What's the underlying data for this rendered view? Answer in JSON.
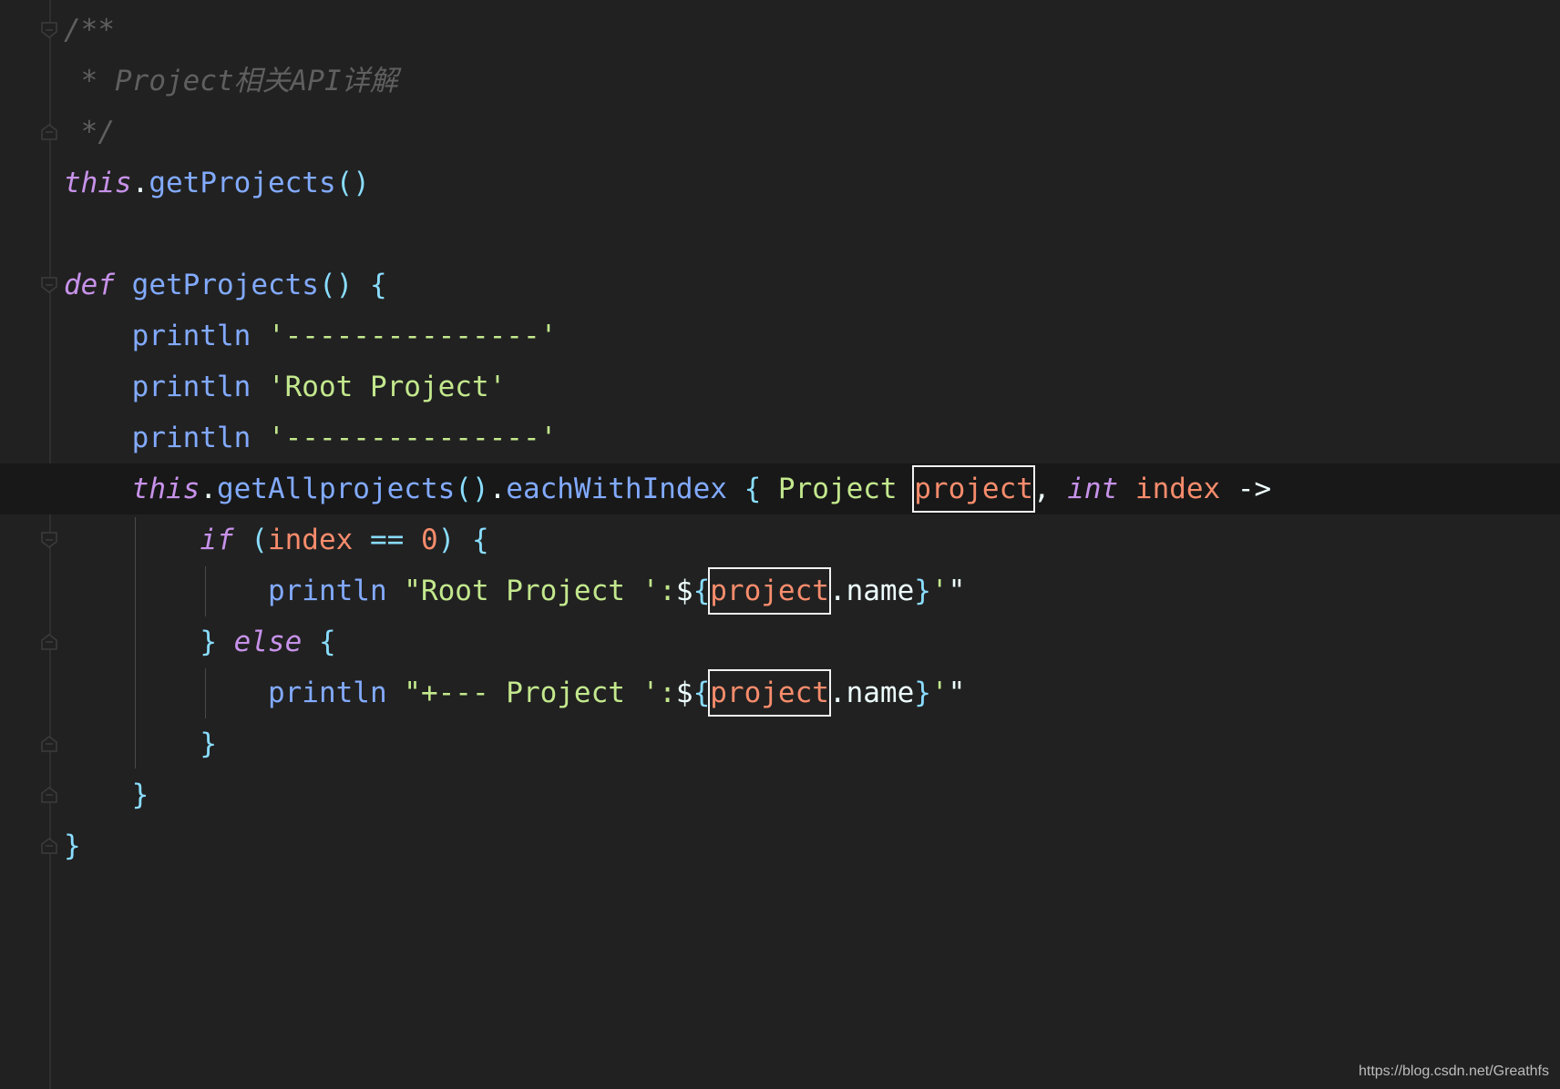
{
  "syntax_colors": {
    "comment": "#5f5f5f",
    "keyword": "#c792ea",
    "function": "#82aaff",
    "punct": "#89ddff",
    "string": "#c3e88d",
    "param": "#f78c6c",
    "plain": "#eeffff",
    "type": "#c3e88d"
  },
  "code_lines": [
    [
      {
        "t": "/**",
        "c": "comment",
        "i": true
      }
    ],
    [
      {
        "t": " * Project相关API详解",
        "c": "comment",
        "i": true
      }
    ],
    [
      {
        "t": " */",
        "c": "comment",
        "i": true
      }
    ],
    [
      {
        "t": "this",
        "c": "keyword",
        "i": true
      },
      {
        "t": ".",
        "c": "plain"
      },
      {
        "t": "getProjects",
        "c": "function"
      },
      {
        "t": "()",
        "c": "punct"
      }
    ],
    [],
    [
      {
        "t": "def",
        "c": "keyword",
        "i": true
      },
      {
        "t": " "
      },
      {
        "t": "getProjects",
        "c": "function"
      },
      {
        "t": "() {",
        "c": "punct"
      }
    ],
    [
      {
        "t": "    "
      },
      {
        "t": "println",
        "c": "function"
      },
      {
        "t": " "
      },
      {
        "t": "'---------------'",
        "c": "string"
      }
    ],
    [
      {
        "t": "    "
      },
      {
        "t": "println",
        "c": "function"
      },
      {
        "t": " "
      },
      {
        "t": "'Root Project'",
        "c": "string"
      }
    ],
    [
      {
        "t": "    "
      },
      {
        "t": "println",
        "c": "function"
      },
      {
        "t": " "
      },
      {
        "t": "'---------------'",
        "c": "string"
      }
    ],
    [
      {
        "t": "    "
      },
      {
        "t": "this",
        "c": "keyword",
        "i": true
      },
      {
        "t": ".",
        "c": "plain"
      },
      {
        "t": "getAllprojects",
        "c": "function"
      },
      {
        "t": "()",
        "c": "punct"
      },
      {
        "t": ".",
        "c": "plain"
      },
      {
        "t": "eachWithIndex",
        "c": "function"
      },
      {
        "t": " { ",
        "c": "punct"
      },
      {
        "t": "Project",
        "c": "type"
      },
      {
        "t": " "
      },
      {
        "t": "project",
        "c": "param",
        "box": true
      },
      {
        "t": ", ",
        "c": "plain"
      },
      {
        "t": "int",
        "c": "keyword",
        "i": true
      },
      {
        "t": " "
      },
      {
        "t": "index",
        "c": "param"
      },
      {
        "t": " ->",
        "c": "plain"
      }
    ],
    [
      {
        "t": "        "
      },
      {
        "t": "if",
        "c": "keyword",
        "i": true
      },
      {
        "t": " (",
        "c": "punct"
      },
      {
        "t": "index",
        "c": "param"
      },
      {
        "t": " == ",
        "c": "punct"
      },
      {
        "t": "0",
        "c": "param"
      },
      {
        "t": ") {",
        "c": "punct"
      }
    ],
    [
      {
        "t": "            "
      },
      {
        "t": "println",
        "c": "function"
      },
      {
        "t": " "
      },
      {
        "t": "\"Root Project ':",
        "c": "string"
      },
      {
        "t": "$",
        "c": "plain"
      },
      {
        "t": "{",
        "c": "punct"
      },
      {
        "t": "project",
        "c": "param",
        "box": true
      },
      {
        "t": ".name",
        "c": "plain"
      },
      {
        "t": "}",
        "c": "punct"
      },
      {
        "t": "'",
        "c": "string"
      },
      {
        "t": "\"",
        "c": "plain"
      }
    ],
    [
      {
        "t": "        "
      },
      {
        "t": "} ",
        "c": "punct"
      },
      {
        "t": "else",
        "c": "keyword",
        "i": true
      },
      {
        "t": " {",
        "c": "punct"
      }
    ],
    [
      {
        "t": "            "
      },
      {
        "t": "println",
        "c": "function"
      },
      {
        "t": " "
      },
      {
        "t": "\"+--- Project ':",
        "c": "string"
      },
      {
        "t": "$",
        "c": "plain"
      },
      {
        "t": "{",
        "c": "punct"
      },
      {
        "t": "project",
        "c": "param",
        "box": true
      },
      {
        "t": ".name",
        "c": "plain"
      },
      {
        "t": "}",
        "c": "punct"
      },
      {
        "t": "'",
        "c": "string"
      },
      {
        "t": "\"",
        "c": "plain"
      }
    ],
    [
      {
        "t": "        "
      },
      {
        "t": "}",
        "c": "punct"
      }
    ],
    [
      {
        "t": "    "
      },
      {
        "t": "}",
        "c": "punct"
      }
    ],
    [
      {
        "t": "}",
        "c": "punct"
      }
    ]
  ],
  "current_line": 9,
  "fold_markers": [
    {
      "line": 0,
      "kind": "open"
    },
    {
      "line": 2,
      "kind": "close"
    },
    {
      "line": 5,
      "kind": "open"
    },
    {
      "line": 9,
      "kind": "open"
    },
    {
      "line": 10,
      "kind": "open"
    },
    {
      "line": 12,
      "kind": "close"
    },
    {
      "line": 14,
      "kind": "close"
    },
    {
      "line": 15,
      "kind": "close"
    },
    {
      "line": 16,
      "kind": "close"
    }
  ],
  "watermark": "https://blog.csdn.net/Greathfs"
}
